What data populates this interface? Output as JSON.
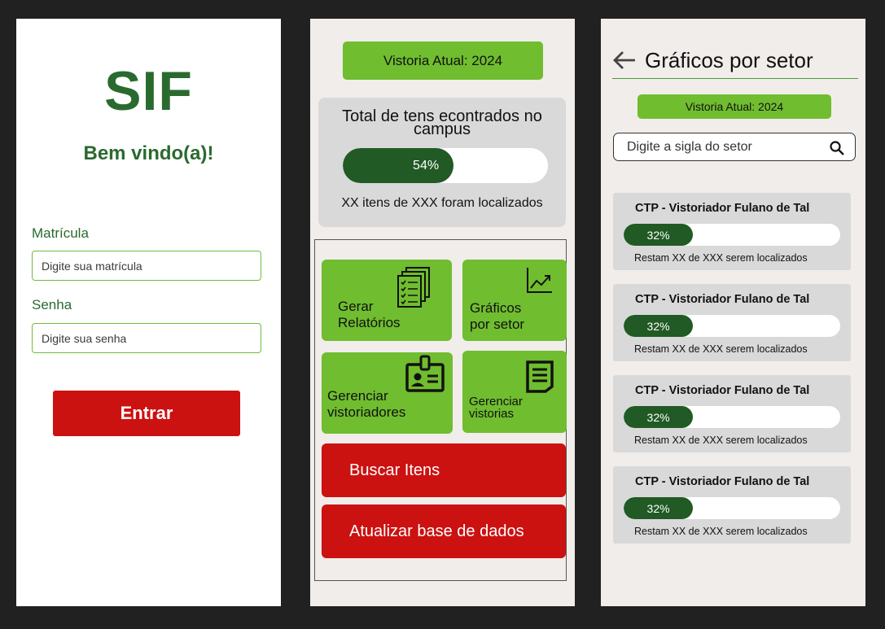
{
  "login": {
    "logo": "SIF",
    "welcome": "Bem vindo(a)!",
    "matricula_label": "Matrícula",
    "matricula_placeholder": "Digite sua matrícula",
    "senha_label": "Senha",
    "senha_placeholder": "Digite sua senha",
    "enter_label": "Entrar"
  },
  "dashboard": {
    "current_inspection": "Vistoria Atual: 2024",
    "total_title": "Total de tens econtrados no campus",
    "progress_percent": 54,
    "progress_label": "54%",
    "total_sub": "XX itens de XXX foram localizados",
    "tiles": {
      "reports": "Gerar\nRelatórios",
      "charts": "Gráficos\npor setor",
      "inspectors": "Gerenciar\nvistoriadores",
      "inspections": "Gerenciar\nvistorias"
    },
    "search_items": "Buscar Itens",
    "update_db": "Atualizar base de dados"
  },
  "sectors": {
    "title": "Gráficos por setor",
    "current_inspection": "Vistoria Atual: 2024",
    "search_placeholder": "Digite a sigla do setor",
    "cards": [
      {
        "name": "CTP - Vistoriador Fulano de Tal",
        "percent": 32,
        "label": "32%",
        "sub": "Restam XX de XXX serem localizados"
      },
      {
        "name": "CTP - Vistoriador Fulano de Tal",
        "percent": 32,
        "label": "32%",
        "sub": "Restam XX de XXX serem localizados"
      },
      {
        "name": "CTP - Vistoriador Fulano de Tal",
        "percent": 32,
        "label": "32%",
        "sub": "Restam XX de XXX serem localizados"
      },
      {
        "name": "CTP - Vistoriador Fulano de Tal",
        "percent": 32,
        "label": "32%",
        "sub": "Restam XX de XXX serem localizados"
      }
    ]
  },
  "colors": {
    "brand_green": "#2a6a2f",
    "accent_green": "#70bd2f",
    "progress_dark": "#215a24",
    "danger_red": "#cc1111"
  },
  "icons": [
    "documents-icon",
    "chart-line-icon",
    "id-badge-icon",
    "document-list-icon",
    "arrow-left-icon",
    "search-icon"
  ]
}
